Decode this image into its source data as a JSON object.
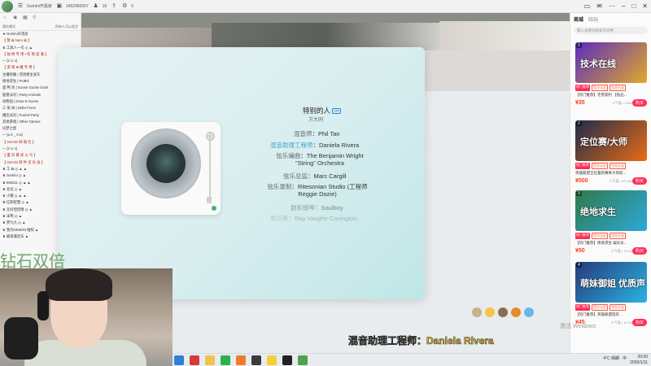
{
  "topbar": {
    "channel_name": "Gemini开黑房",
    "room_id": "1462960067",
    "followers": "19",
    "counter": "0"
  },
  "left_panel": {
    "header_left": "我在模式",
    "header_right": "所有人可以发言",
    "lines": [
      "★ Gemini开黑房",
      "【 暂 ✿ Nero ✿ 】",
      "♛ 工具人一号 ◎ ▲",
      "【 独 特 专 用 • 有 限 度 满 】",
      "— [ɪ 'ɑː ɛ]",
      "【 游 戏 ❀ 魔 专 用 】",
      "主播陪睡 | 宣扬想主发车",
      "绝地求生 | PUBG",
      "蛋 鸭 杀 | Goose Goose Duck",
      "猛兽派对 | Party Animals",
      "动物园 | Draw & Guess",
      "三 角 洲 | Delta Force",
      "播出派对 | Funnel Party",
      "其他游戏 | Other Games",
      "玩梦之屋",
      "— [ɑ 5 _ 6 ɑ]",
      "【 Gemini 邮 箱 栏 】",
      "— [ɪ 'ɑː ɛ]",
      "【 置 日 最 样 公 号 】",
      "【 Gemini 邮 件 音 乐 会 】",
      "♛ 工 ✿ ◎ ▲ ▲",
      "♛ Gemini ◎ ▲",
      "♛ k65211 ◎ ▲ ▲",
      "♛ 北北 ◎ ▲",
      "♛ 小猪 ◎ ▲ ▲",
      "♛ 信和智慧 ◎ ▲",
      "♛ 无好惜惜情 ◎ ▲",
      "♛ 末鸭 ◎ ▲",
      "♛ 梦九九 ◎ ▲",
      "♛ 我为GEMINI 拍照 ▲",
      "♛ 被欲满音乐 ▲"
    ]
  },
  "right_panel": {
    "tab_active": "商城",
    "tab_other": "陪玩",
    "search_placeholder": "输入关键词搜索可优惠",
    "cards": [
      {
        "idx": "1",
        "img_text": "技术在线",
        "tag1": "热门推荐",
        "tag2": "官方认证",
        "tag3": "包含元宝",
        "title": "【热门推荐】无畏契约 【钻石...",
        "price": "¥35",
        "sold": "人气值 • 126w",
        "buy": "购买",
        "color1": "#5b2bbf",
        "color2": "#e0a92a"
      },
      {
        "idx": "2",
        "img_text": "定位赛/大师",
        "tag1": "热门推荐",
        "tag2": "官方认证",
        "tag3": "包含元宝",
        "title": "英雄联盟全位置新赛季大师段...",
        "price": "¥500",
        "sold": "人气值 • 671.8w",
        "buy": "购买",
        "color1": "#1d2b4a",
        "color2": "#e96c16"
      },
      {
        "idx": "3",
        "img_text": "绝地求生",
        "tag1": "热门推荐",
        "tag2": "官方认证",
        "tag3": "包含元宝",
        "title": "【热门推荐】绝地求生 娱乐女...",
        "price": "¥50",
        "sold": "人气值 • 76.1w",
        "buy": "购买",
        "color1": "#2f7a4a",
        "color2": "#2ea8d8"
      },
      {
        "idx": "4",
        "img_text": "萌妹御姐 优质声",
        "tag1": "热门推荐",
        "tag2": "官方认证",
        "tag3": "包含元宝",
        "title": "【热门推荐】英雄联盟陪玩 ...",
        "price": "¥45",
        "sold": "人气值 • 10.3w",
        "buy": "购买",
        "color1": "#263a7a",
        "color2": "#2ab3e3"
      }
    ]
  },
  "modal": {
    "song_title": "特别的人",
    "vip": "VIP",
    "artist": "方大同",
    "credits": [
      {
        "k": "混音师",
        "v": "Phil Tan"
      },
      {
        "k": "混音助理工程师",
        "v": "Daniela Rivera"
      },
      {
        "k": "弦乐编曲",
        "v": "The Benjamin Wright \"String\" Orchestra"
      },
      {
        "k": "弦乐总监",
        "v": "Marc Cargill"
      },
      {
        "k": "弦乐录制",
        "v": "Ritesonian Studio (工程师Reggie Dozie)"
      },
      {
        "k": "鼓和钢琴",
        "v": "Soulboy"
      },
      {
        "k": "电贝斯",
        "v": "Ray Vaughn Covington"
      }
    ]
  },
  "overlay": {
    "watermark": "钻石双倍",
    "lyric_line": "混音助理工程师：Daniela Rivera",
    "activate_text": "激活 Windows"
  },
  "taskbar": {
    "weather": "4°C 晴朗",
    "ime": "中",
    "time": "20:00",
    "date": "2026/1/11"
  },
  "colors": {
    "accent_red": "#ff2e55",
    "price_red": "#ff3a1c",
    "lyric_yellow": "#f0c418",
    "modal_teal": "#bfe6e6"
  }
}
